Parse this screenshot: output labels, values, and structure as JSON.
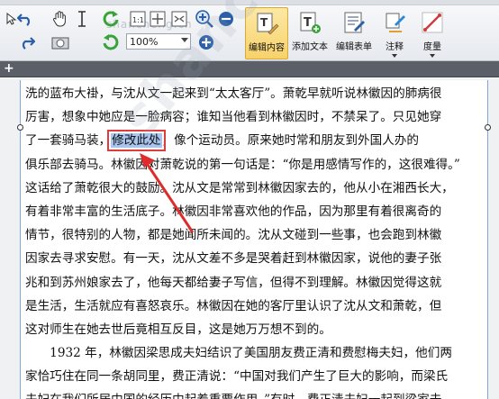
{
  "ribbon": {
    "zoom_value": "100%",
    "watermark": "shancheng.cn",
    "buttons": {
      "edit_content": "编辑内容",
      "add_text": "添加文本",
      "edit_form": "编辑表单",
      "annotate": "注释",
      "measure": "度量"
    }
  },
  "tabbar": {
    "new_tab": "+"
  },
  "document": {
    "lines": [
      [
        "洗的蓝布大褂，与沈从文一起来到“太太客厅”。萧乾早就听说林徽因的肺病很"
      ],
      [
        "厉害，想象中她应是一脸病容；谁知当他看到林徽因时，不禁呆了。只见她穿"
      ],
      [
        "了一套骑马装，",
        "修改此处",
        "，像个运动员。原来她时常和朋友到外国人办的"
      ],
      [
        "俱乐部去骑马。林徽因对萧乾说的第一句话是：“你是用感情写作的，这很难得。”"
      ],
      [
        "这话给了萧乾很大的鼓励。沈从文是常常到林徽因家去的，他从小在湘西长大，"
      ],
      [
        "有着非常丰富的生活底子。林徽因非常喜欢他的作品，因为那里有着很离奇的"
      ],
      [
        "情节，很特别的人物，都是她闻所未闻的。沈从文碰到一些事，也会跑到林徽"
      ],
      [
        "因家去寻求安慰。有一天，沈从文差不多是哭着赶到林徽因家，说他的妻子张"
      ],
      [
        "兆和到苏州娘家去了，他每天都给妻子写信，但得不到理解。林徽因觉得这就"
      ],
      [
        "是生活，生活就应有喜怒哀乐。林徽因在她的客厅里认识了沈从文和萧乾，但"
      ],
      [
        "这对师生在她去世后竟相互反目，这是她万万想不到的。"
      ],
      [
        "　　1932 年，林徽因梁思成夫妇结识了美国朋友费正清和费慰梅夫妇，他们两"
      ],
      [
        "家恰巧住在同一条胡同里，费正清说：“中国对我们产生了巨大的影响，而梁氏"
      ],
      [
        "夫妇在我们所居中国的经历中起着重要作用。”有时，费正清夫妇一起到梁家去，"
      ]
    ],
    "watermark": "shancheng.cn"
  }
}
